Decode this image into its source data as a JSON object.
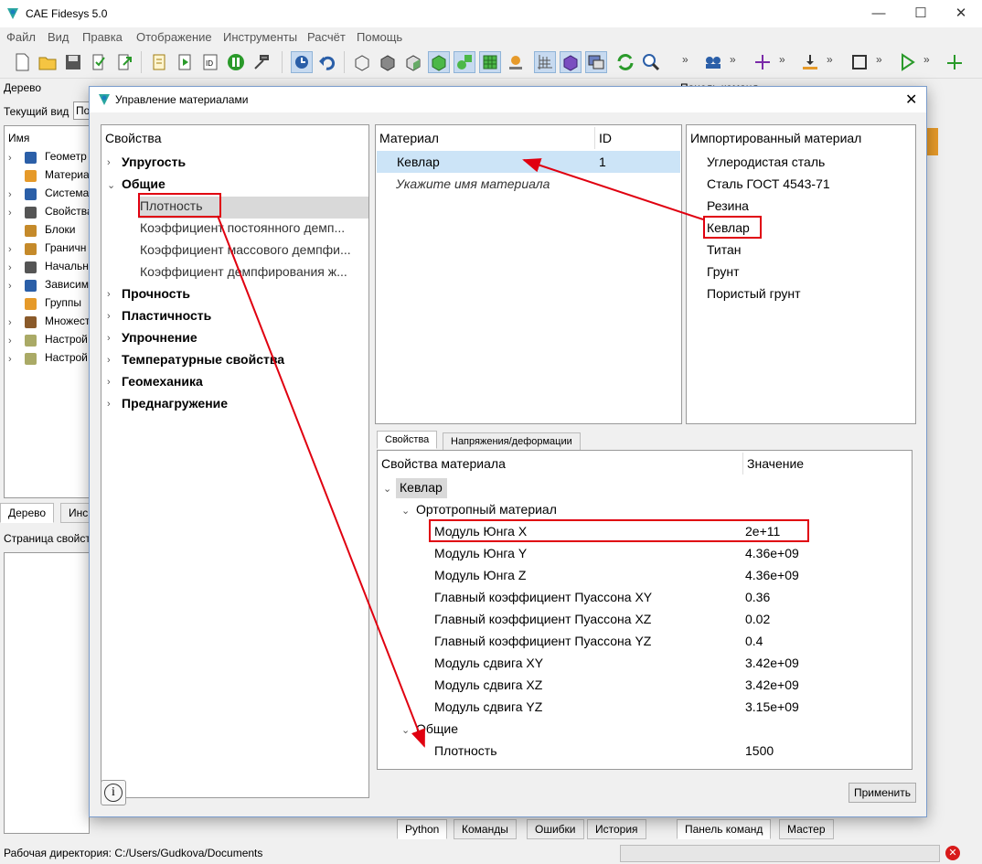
{
  "app": {
    "title": "CAE Fidesys 5.0"
  },
  "menu": [
    "Файл",
    "Вид",
    "Правка",
    "Отображение",
    "Инструменты",
    "Расчёт",
    "Помощь"
  ],
  "left_dock": {
    "title": "Дерево",
    "view_label": "Текущий вид",
    "view_value": "По",
    "col_name": "Имя",
    "items": [
      "Геометр",
      "Материа",
      "Система",
      "Свойства",
      "Блоки",
      "Граничн",
      "Начальн",
      "Зависим",
      "Группы",
      "Множест",
      "Настрой",
      "Настрой"
    ],
    "tabs": [
      "Дерево",
      "Инс"
    ],
    "props_title": "Страница свойст"
  },
  "right_dock": {
    "title": "Панель команд"
  },
  "dialog": {
    "title": "Управление материалами",
    "props_tree": {
      "header": "Свойства",
      "groups": [
        {
          "label": "Упругость"
        },
        {
          "label": "Общие",
          "children": [
            "Плотность",
            "Коэффициент постоянного демп...",
            "Коэффициент массового демпфи...",
            "Коэффициент демпфирования ж..."
          ]
        },
        {
          "label": "Прочность"
        },
        {
          "label": "Пластичность"
        },
        {
          "label": "Упрочнение"
        },
        {
          "label": "Температурные свойства"
        },
        {
          "label": "Геомеханика"
        },
        {
          "label": "Преднагружение"
        }
      ]
    },
    "materials": {
      "col_material": "Материал",
      "col_id": "ID",
      "rows": [
        {
          "name": "Кевлар",
          "id": "1"
        }
      ],
      "placeholder": "Укажите имя материала"
    },
    "imported": {
      "header": "Импортированный материал",
      "items": [
        "Углеродистая сталь",
        "Сталь ГОСТ 4543-71",
        "Резина",
        "Кевлар",
        "Титан",
        "Грунт",
        "Пористый грунт"
      ]
    },
    "tabs": [
      "Свойства",
      "Напряжения/деформации"
    ],
    "props_table": {
      "col_prop": "Свойства материала",
      "col_value": "Значение",
      "root": "Кевлар",
      "sections": [
        {
          "label": "Ортотропный материал",
          "rows": [
            {
              "name": "Модуль Юнга X",
              "value": "2e+11"
            },
            {
              "name": "Модуль Юнга Y",
              "value": "4.36e+09"
            },
            {
              "name": "Модуль Юнга Z",
              "value": "4.36e+09"
            },
            {
              "name": "Главный коэффициент Пуассона XY",
              "value": "0.36"
            },
            {
              "name": "Главный коэффициент Пуассона XZ",
              "value": "0.02"
            },
            {
              "name": "Главный коэффициент Пуассона YZ",
              "value": "0.4"
            },
            {
              "name": "Модуль сдвига XY",
              "value": "3.42e+09"
            },
            {
              "name": "Модуль сдвига XZ",
              "value": "3.42e+09"
            },
            {
              "name": "Модуль сдвига YZ",
              "value": "3.15e+09"
            }
          ]
        },
        {
          "label": "Общие",
          "rows": [
            {
              "name": "Плотность",
              "value": "1500"
            }
          ]
        }
      ]
    },
    "apply_label": "Применить",
    "info_glyph": "i"
  },
  "bottom_tabs": [
    "Python",
    "Команды",
    "Ошибки",
    "История"
  ],
  "right_bottom_tabs": [
    "Панель команд",
    "Мастер"
  ],
  "status": {
    "workdir": "Рабочая директория: C:/Users/Gudkova/Documents"
  },
  "colors": {
    "accent_red": "#e00010",
    "selection": "#cce4f7"
  }
}
